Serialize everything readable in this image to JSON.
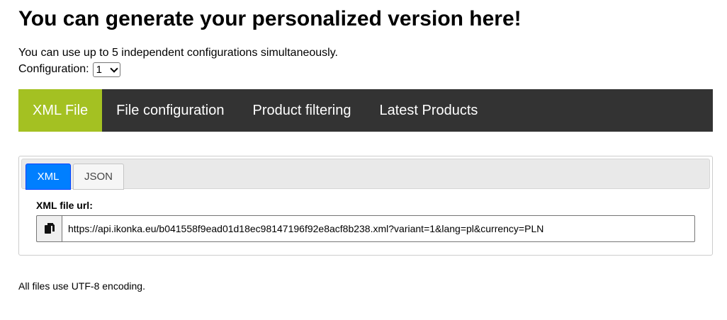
{
  "header": {
    "title": "You can generate your personalized version here!",
    "intro": "You can use up to 5 independent configurations simultaneously."
  },
  "configuration": {
    "label": "Configuration:",
    "selected": "1",
    "icon": "chevron-down-icon"
  },
  "main_tabs": [
    {
      "label": "XML File",
      "active": true
    },
    {
      "label": "File configuration",
      "active": false
    },
    {
      "label": "Product filtering",
      "active": false
    },
    {
      "label": "Latest Products",
      "active": false
    }
  ],
  "format_tabs": [
    {
      "label": "XML",
      "active": true
    },
    {
      "label": "JSON",
      "active": false
    }
  ],
  "xml_panel": {
    "field_label": "XML file url:",
    "url": "https://api.ikonka.eu/b041558f9ead01d18ec98147196f92e8acf8b238.xml?variant=1&lang=pl&currency=PLN",
    "copy_icon": "copy-icon"
  },
  "footer": {
    "note": "All files use UTF-8 encoding."
  },
  "colors": {
    "nav_background": "#333333",
    "active_tab": "#a4c122",
    "active_subtab": "#007fff"
  }
}
